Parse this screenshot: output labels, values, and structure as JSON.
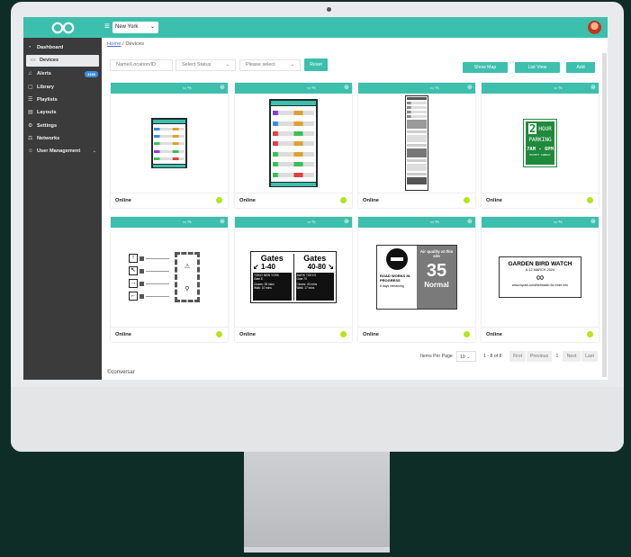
{
  "header": {
    "location_selected": "New York"
  },
  "sidebar": {
    "items": [
      {
        "label": "Dashboard",
        "icon": "gauge-icon"
      },
      {
        "label": "Devices",
        "icon": "monitor-icon",
        "active": true
      },
      {
        "label": "Alerts",
        "icon": "bell-icon",
        "badge": "3193"
      },
      {
        "label": "Library",
        "icon": "folder-icon"
      },
      {
        "label": "Playlists",
        "icon": "list-icon"
      },
      {
        "label": "Layouts",
        "icon": "layout-icon"
      },
      {
        "label": "Settings",
        "icon": "gear-icon"
      },
      {
        "label": "Networks",
        "icon": "network-icon"
      },
      {
        "label": "User Management",
        "icon": "users-icon"
      }
    ]
  },
  "breadcrumb": {
    "home": "Home",
    "separator": "/",
    "current": "Devices"
  },
  "filters": {
    "search_placeholder": "Name/Location/ID",
    "status_placeholder": "Select Status",
    "other_placeholder": "Please select",
    "reset_label": "Reset",
    "show_map_label": "Show Map",
    "list_view_label": "List View",
    "add_label": "Add"
  },
  "devices": [
    {
      "status": "Online"
    },
    {
      "status": "Online"
    },
    {
      "status": "Online"
    },
    {
      "status": "Online"
    },
    {
      "status": "Online"
    },
    {
      "status": "Online"
    },
    {
      "status": "Online"
    },
    {
      "status": "Online"
    }
  ],
  "thumbs": {
    "parking": {
      "line1": "2",
      "line2": "HOUR",
      "line3": "PARKING",
      "line4": "7AM - 6PM",
      "line5": "EXCEPT SUNDAY"
    },
    "gates": {
      "left": {
        "title": "Gates",
        "range": "1-40",
        "sub1": "TOKIO NEW YORK",
        "sub2": "Gate 8",
        "l1": "Closes: 28 mins",
        "l2": "Walk: 10 mins"
      },
      "right": {
        "title": "Gates",
        "range": "40-80",
        "sub1": "AWOK TOKYO",
        "sub2": "Gate 70",
        "l1": "Closes: 40 mins",
        "l2": "Walk: 17 mins"
      }
    },
    "air": {
      "roadworks": "ROAD WORKS IN PROGRESS",
      "days": "5 days remaining",
      "air_title": "Air quality at this site",
      "value": "35",
      "label": "Normal"
    },
    "bird": {
      "title": "GARDEN BIRD WATCH",
      "dates": "6-12 MARCH 2024",
      "url": "www.rspark.com/birdwatch for more info"
    }
  },
  "pagination": {
    "items_per_page_label": "Items Per Page",
    "items_per_page": "10",
    "range": "1 - 8 of 8",
    "first": "First",
    "previous": "Previous",
    "page": "1",
    "next": "Next",
    "last": "Last"
  },
  "footer": {
    "text": "©conversar"
  },
  "colors": {
    "accent": "#3dbfad",
    "sidebar": "#3b3b3b",
    "online": "#b5e51c"
  }
}
